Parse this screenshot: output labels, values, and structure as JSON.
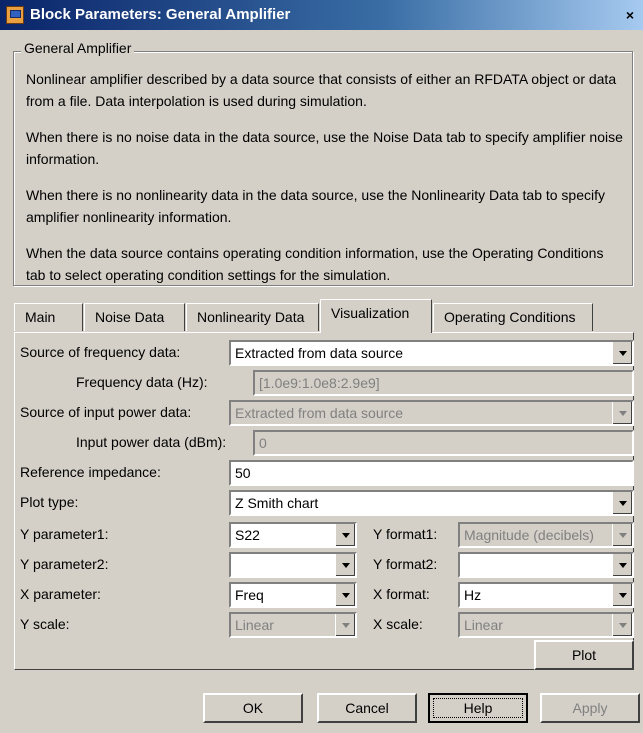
{
  "window": {
    "title": "Block Parameters: General Amplifier",
    "close": "×"
  },
  "group": {
    "legend": "General Amplifier",
    "paragraphs": [
      "Nonlinear amplifier described by a data source that consists of either an RFDATA object or data from a file. Data interpolation is used during simulation.",
      "When there is no noise data in the data source, use the Noise Data tab to specify amplifier noise information.",
      "When there is no nonlinearity data in the data source, use the Nonlinearity Data tab to specify amplifier nonlinearity information.",
      "When the data source contains operating condition information, use the Operating Conditions tab to select operating condition settings for the simulation."
    ]
  },
  "tabs": [
    "Main",
    "Noise Data",
    "Nonlinearity Data",
    "Visualization",
    "Operating Conditions"
  ],
  "active_tab": "Visualization",
  "form": {
    "freq_source_label": "Source of frequency data:",
    "freq_source_value": "Extracted from data source",
    "freq_data_label": "Frequency data (Hz):",
    "freq_data_value": "[1.0e9:1.0e8:2.9e9]",
    "power_source_label": "Source of input power data:",
    "power_source_value": "Extracted from data source",
    "power_data_label": "Input power data (dBm):",
    "power_data_value": "0",
    "ref_imp_label": "Reference impedance:",
    "ref_imp_value": "50",
    "plot_type_label": "Plot type:",
    "plot_type_value": "Z Smith chart",
    "yparam1_label": "Y parameter1:",
    "yparam1_value": "S22",
    "yformat1_label": "Y format1:",
    "yformat1_value": "Magnitude (decibels)",
    "yparam2_label": "Y parameter2:",
    "yparam2_value": "",
    "yformat2_label": "Y format2:",
    "yformat2_value": "",
    "xparam_label": "X parameter:",
    "xparam_value": "Freq",
    "xformat_label": "X format:",
    "xformat_value": "Hz",
    "yscale_label": "Y scale:",
    "yscale_value": "Linear",
    "xscale_label": "X scale:",
    "xscale_value": "Linear",
    "plot_button": "Plot"
  },
  "buttons": {
    "ok": "OK",
    "cancel": "Cancel",
    "help": "Help",
    "apply": "Apply"
  }
}
